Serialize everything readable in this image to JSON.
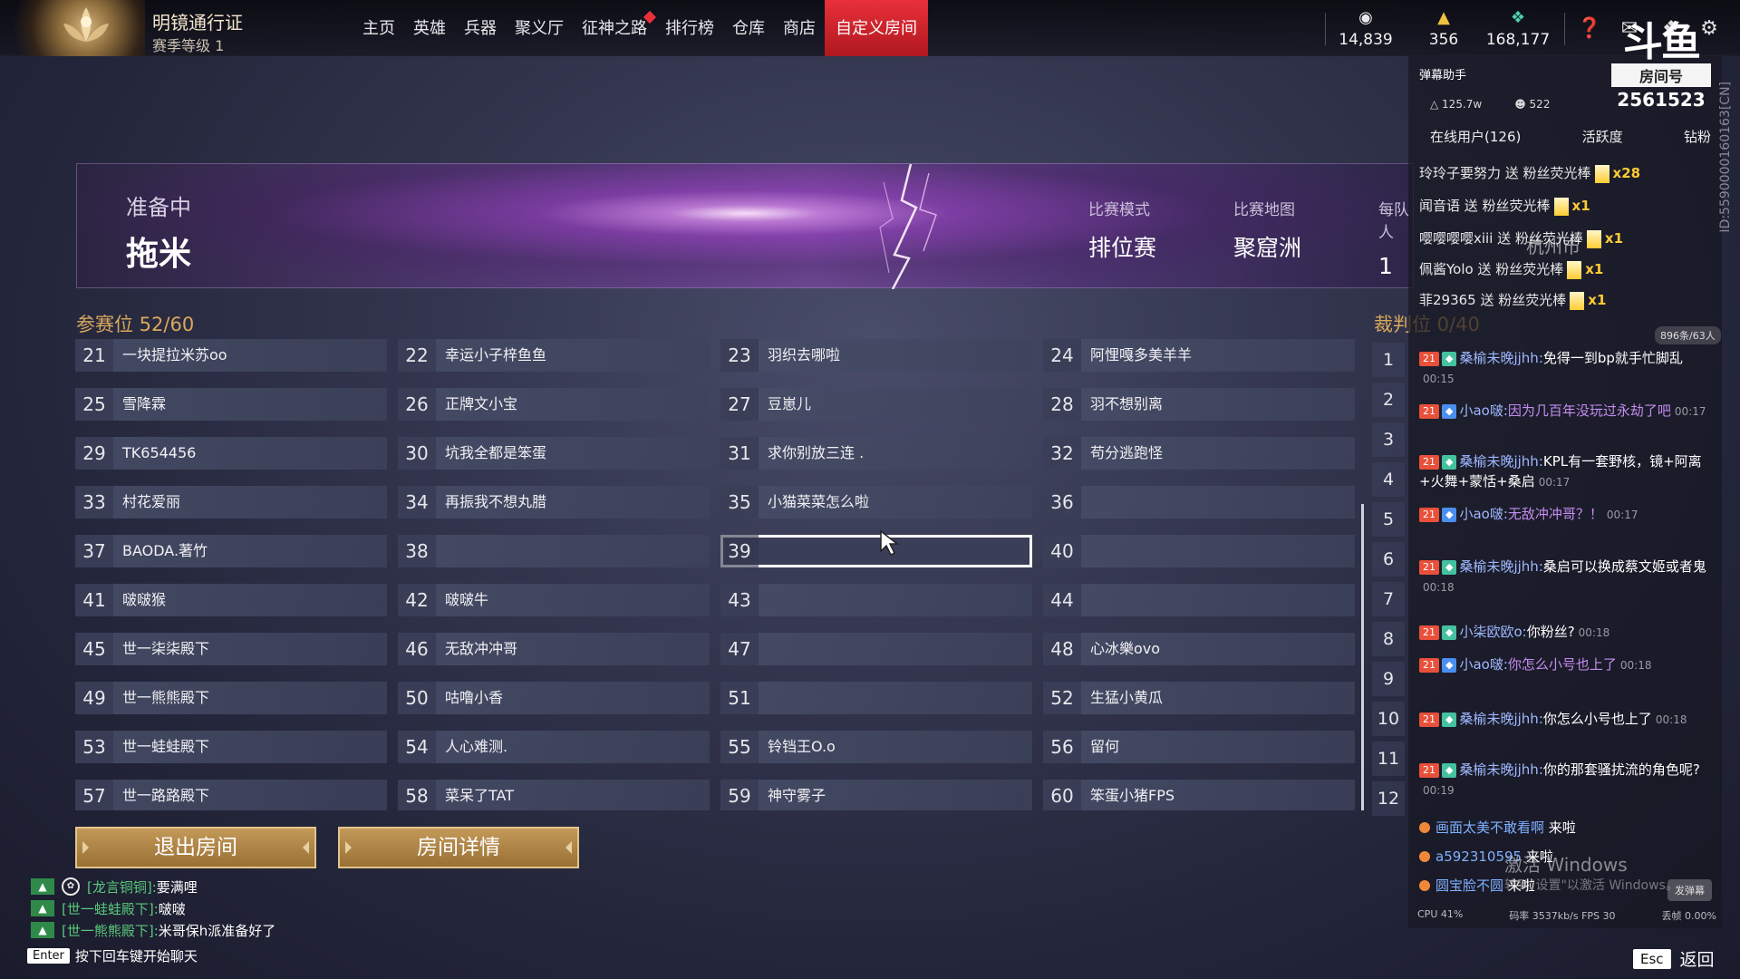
{
  "topbar": {
    "pass_title": "明镜通行证",
    "pass_level": "赛季等级 1",
    "nav": [
      {
        "label": "主页",
        "dot": false,
        "active": false
      },
      {
        "label": "英雄",
        "dot": false,
        "active": false
      },
      {
        "label": "兵器",
        "dot": false,
        "active": false
      },
      {
        "label": "聚义厅",
        "dot": false,
        "active": false
      },
      {
        "label": "征神之路",
        "dot": true,
        "active": false
      },
      {
        "label": "排行榜",
        "dot": false,
        "active": false
      },
      {
        "label": "仓库",
        "dot": false,
        "active": false
      },
      {
        "label": "商店",
        "dot": false,
        "active": false
      },
      {
        "label": "自定义房间",
        "dot": false,
        "active": true
      }
    ],
    "currencies": [
      {
        "icon": "coin-stack-icon",
        "value": "14,839"
      },
      {
        "icon": "gold-ingot-icon",
        "value": "356"
      },
      {
        "icon": "feather-icon",
        "value": "168,177"
      }
    ],
    "icons": [
      "help-icon",
      "mail-icon",
      "gift-icon",
      "settings-icon"
    ]
  },
  "banner": {
    "status": "准备中",
    "host": "拖米",
    "mode_label": "比赛模式",
    "mode_value": "排位赛",
    "map_label": "比赛地图",
    "map_value": "聚窟洲",
    "team_label": "每队人",
    "team_value": "1"
  },
  "participants": {
    "title": "参赛位 52/60",
    "slots": [
      {
        "n": "21",
        "name": "一块提拉米苏oo"
      },
      {
        "n": "22",
        "name": "幸运小子梓鱼鱼"
      },
      {
        "n": "23",
        "name": "羽织去哪啦"
      },
      {
        "n": "24",
        "name": "阿悝嘎多美羊羊"
      },
      {
        "n": "25",
        "name": "雪降霖"
      },
      {
        "n": "26",
        "name": "正牌文小宝"
      },
      {
        "n": "27",
        "name": "豆崽儿"
      },
      {
        "n": "28",
        "name": "羽不想别离"
      },
      {
        "n": "29",
        "name": "TK654456"
      },
      {
        "n": "30",
        "name": "坑我全都是笨蛋"
      },
      {
        "n": "31",
        "name": "求你别放三连 ."
      },
      {
        "n": "32",
        "name": "苟分逃跑怪"
      },
      {
        "n": "33",
        "name": "村花爱丽"
      },
      {
        "n": "34",
        "name": "再振我不想丸腊"
      },
      {
        "n": "35",
        "name": "小猫菜菜怎么啦"
      },
      {
        "n": "36",
        "name": ""
      },
      {
        "n": "37",
        "name": "BAODA.著竹"
      },
      {
        "n": "38",
        "name": ""
      },
      {
        "n": "39",
        "name": ""
      },
      {
        "n": "40",
        "name": ""
      },
      {
        "n": "41",
        "name": "啵啵猴"
      },
      {
        "n": "42",
        "name": "啵啵牛"
      },
      {
        "n": "43",
        "name": ""
      },
      {
        "n": "44",
        "name": ""
      },
      {
        "n": "45",
        "name": "世一柒柒殿下"
      },
      {
        "n": "46",
        "name": "无敌冲冲哥"
      },
      {
        "n": "47",
        "name": ""
      },
      {
        "n": "48",
        "name": "心冰樂ovo"
      },
      {
        "n": "49",
        "name": "世一熊熊殿下"
      },
      {
        "n": "50",
        "name": "咕噜小香"
      },
      {
        "n": "51",
        "name": ""
      },
      {
        "n": "52",
        "name": "生猛小黄瓜"
      },
      {
        "n": "53",
        "name": "世一蛙蛙殿下"
      },
      {
        "n": "54",
        "name": "人心难测."
      },
      {
        "n": "55",
        "name": "铃铛王O.o"
      },
      {
        "n": "56",
        "name": "留何"
      },
      {
        "n": "57",
        "name": "世一路路殿下"
      },
      {
        "n": "58",
        "name": "菜呆了TAT"
      },
      {
        "n": "59",
        "name": "神守雾子"
      },
      {
        "n": "60",
        "name": "笨蛋小猪FPS"
      }
    ],
    "selected": "39"
  },
  "referees": {
    "title": "裁判位 0/40",
    "numbers": [
      "1",
      "2",
      "3",
      "4",
      "5",
      "6",
      "7",
      "8",
      "9",
      "10",
      "11",
      "12"
    ]
  },
  "buttons": {
    "exit": "退出房间",
    "details": "房间详情"
  },
  "chat": [
    {
      "name": "[龙言铜铜]:",
      "msg": "要满哩",
      "logo": true
    },
    {
      "name": "[世一蛙蛙殿下]:",
      "msg": "啵啵",
      "logo": false
    },
    {
      "name": "[世一熊熊殿下]:",
      "msg": "米哥保h派准备好了",
      "logo": false
    }
  ],
  "enter_hint": {
    "key": "Enter",
    "text": "按下回车键开始聊天"
  },
  "esc_hint": {
    "key": "Esc",
    "text": "返回"
  },
  "overlay": {
    "title": "弹幕助手",
    "heat": "125.7w",
    "fans": "522",
    "tabs": [
      "在线用户(126)",
      "活跃度",
      "钻粉"
    ],
    "room_logo": "斗鱼",
    "room_label": "房间号",
    "room_id": "2561523",
    "side_id": "ID:5590000160163[CN]",
    "city": "杭州市",
    "gifts": [
      {
        "text": "玲玲子要努力 送 粉丝荧光棒",
        "count": "x28"
      },
      {
        "text": "闻音语 送 粉丝荧光棒",
        "count": "x1"
      },
      {
        "text": "嘤嘤嘤嘤xiii 送 粉丝荧光棒",
        "count": "x1"
      },
      {
        "text": "佩酱Yolo 送 粉丝荧光棒",
        "count": "x1"
      },
      {
        "text": "菲29365 送 粉丝荧光棒",
        "count": "x1"
      }
    ],
    "count_pill": "896条/63人",
    "danmaku": [
      {
        "user": "桑榆未晚jjhh:",
        "msg": "免得一到bp就手忙脚乱",
        "time": "00:15",
        "purple": false
      },
      {
        "user": "小ao啵:",
        "msg": "因为几百年没玩过永劫了吧",
        "time": "00:17",
        "purple": true
      },
      {
        "user": "桑榆未晚jjhh:",
        "msg": "KPL有一套野核，镜+阿离+火舞+蒙恬+桑启",
        "time": "00:17",
        "purple": false
      },
      {
        "user": "小ao啵:",
        "msg": "无敌冲冲哥？！",
        "time": "00:17",
        "purple": true
      },
      {
        "user": "桑榆未晚jjhh:",
        "msg": "桑启可以换成蔡文姬或者鬼",
        "time": "00:18",
        "purple": false
      },
      {
        "user": "小柒欧欧o:",
        "msg": "你粉丝?",
        "time": "00:18",
        "purple": false
      },
      {
        "user": "小ao啵:",
        "msg": "你怎么小号也上了",
        "time": "00:18",
        "purple": true
      },
      {
        "user": "桑榆未晚jjhh:",
        "msg": "你怎么小号也上了",
        "time": "00:18",
        "purple": false
      },
      {
        "user": "桑榆未晚jjhh:",
        "msg": "你的那套骚扰流的角色呢?",
        "time": "00:19",
        "purple": false
      }
    ],
    "short_msgs": [
      {
        "user": "画面太美不敢看啊",
        "msg": "来啦"
      },
      {
        "user": "a592310595",
        "msg": "来啦"
      },
      {
        "user": "圆宝脸不圆",
        "msg": "来啦"
      }
    ],
    "watermark": "激活 Windows",
    "watermark_sub": "转到\"设置\"以激活 Windows。",
    "send_btn": "发弹幕",
    "footer": [
      "CPU 41%",
      "码率 3537kb/s FPS 30",
      "丢帧 0.00%"
    ]
  }
}
